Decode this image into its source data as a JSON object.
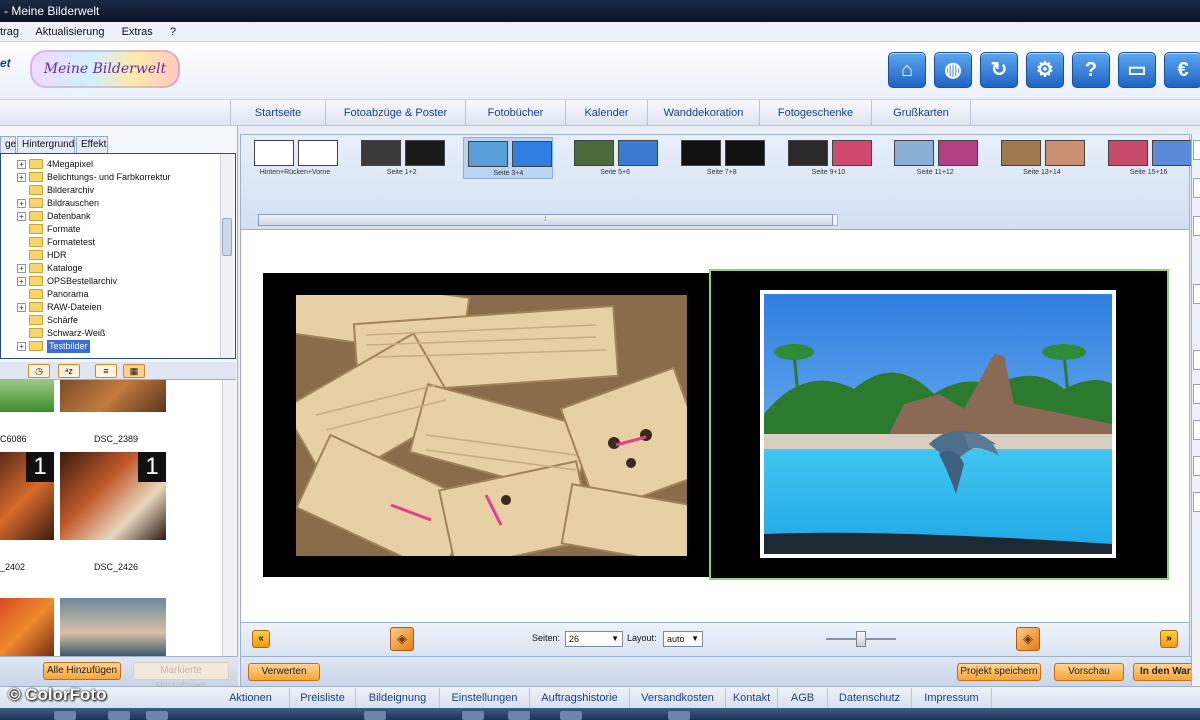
{
  "window": {
    "title": "- Meine Bilderwelt"
  },
  "menu": {
    "items": [
      "trag",
      "Aktualisierung",
      "Extras",
      "?"
    ]
  },
  "header": {
    "logo_left": "et",
    "logo_text": "Meine Bilderwelt",
    "icons": [
      "home-icon",
      "globe-icon",
      "refresh-icon",
      "settings-icon",
      "help-icon",
      "folder-icon",
      "euro-icon"
    ]
  },
  "nav": {
    "tabs": [
      "Startseite",
      "Fotoabzüge & Poster",
      "Fotobücher",
      "Kalender",
      "Wanddekoration",
      "Fotogeschenke",
      "Grußkarten"
    ]
  },
  "left": {
    "tabs": [
      "ge",
      "Hintergrund",
      "Effekt"
    ],
    "tree": [
      "4Megapixel",
      "Belichtungs- und Farbkorrektur",
      "Bilderarchiv",
      "Bildrauschen",
      "Datenbank",
      "Formate",
      "Formatetest",
      "HDR",
      "Kataloge",
      "OPSBestellarchiv",
      "Panorama",
      "RAW-Dateien",
      "Schärfe",
      "Schwarz-Weiß",
      "Testbilder"
    ],
    "tree_expandable": [
      true,
      true,
      false,
      true,
      true,
      false,
      false,
      false,
      true,
      true,
      false,
      true,
      false,
      false,
      true
    ],
    "selected": "Testbilder",
    "thumbs": [
      {
        "label": "C6086",
        "badge": ""
      },
      {
        "label": "DSC_2389",
        "badge": ""
      },
      {
        "label": "_2402",
        "badge": "1"
      },
      {
        "label": "DSC_2426",
        "badge": "1"
      },
      {
        "label": "",
        "badge": ""
      },
      {
        "label": "",
        "badge": ""
      }
    ],
    "add_all": "Alle Hinzufügen",
    "add_marked": "Markierte Hinzufügen"
  },
  "strip": {
    "pages": [
      "Hinten+Rücken+Vorne",
      "Seite 1+2",
      "Seite 3+4",
      "Seite 5+6",
      "Seite 7+8",
      "Seite 9+10",
      "Seite 11+12",
      "Seite 13+14",
      "Seite 15+16"
    ],
    "selected_index": 2
  },
  "controls": {
    "seiten_label": "Seiten:",
    "seiten_value": "26",
    "layout_label": "Layout:",
    "layout_value": "auto",
    "prev": "«",
    "next": "»"
  },
  "actions": {
    "verwerten": "Verwerten",
    "save": "Projekt speichern",
    "preview": "Vorschau",
    "cart": "In den Warenkorb"
  },
  "footer": {
    "watermark": "© ColorFoto",
    "tabs": [
      "Aktionen",
      "Preisliste",
      "Bildeignung",
      "Einstellungen",
      "Auftragshistorie",
      "Versandkosten",
      "Kontakt",
      "AGB",
      "Datenschutz",
      "Impressum"
    ]
  },
  "colors": {
    "accent": "#1f63c4",
    "button_orange": "#f7a43a",
    "selection": "#3b6fd6"
  }
}
